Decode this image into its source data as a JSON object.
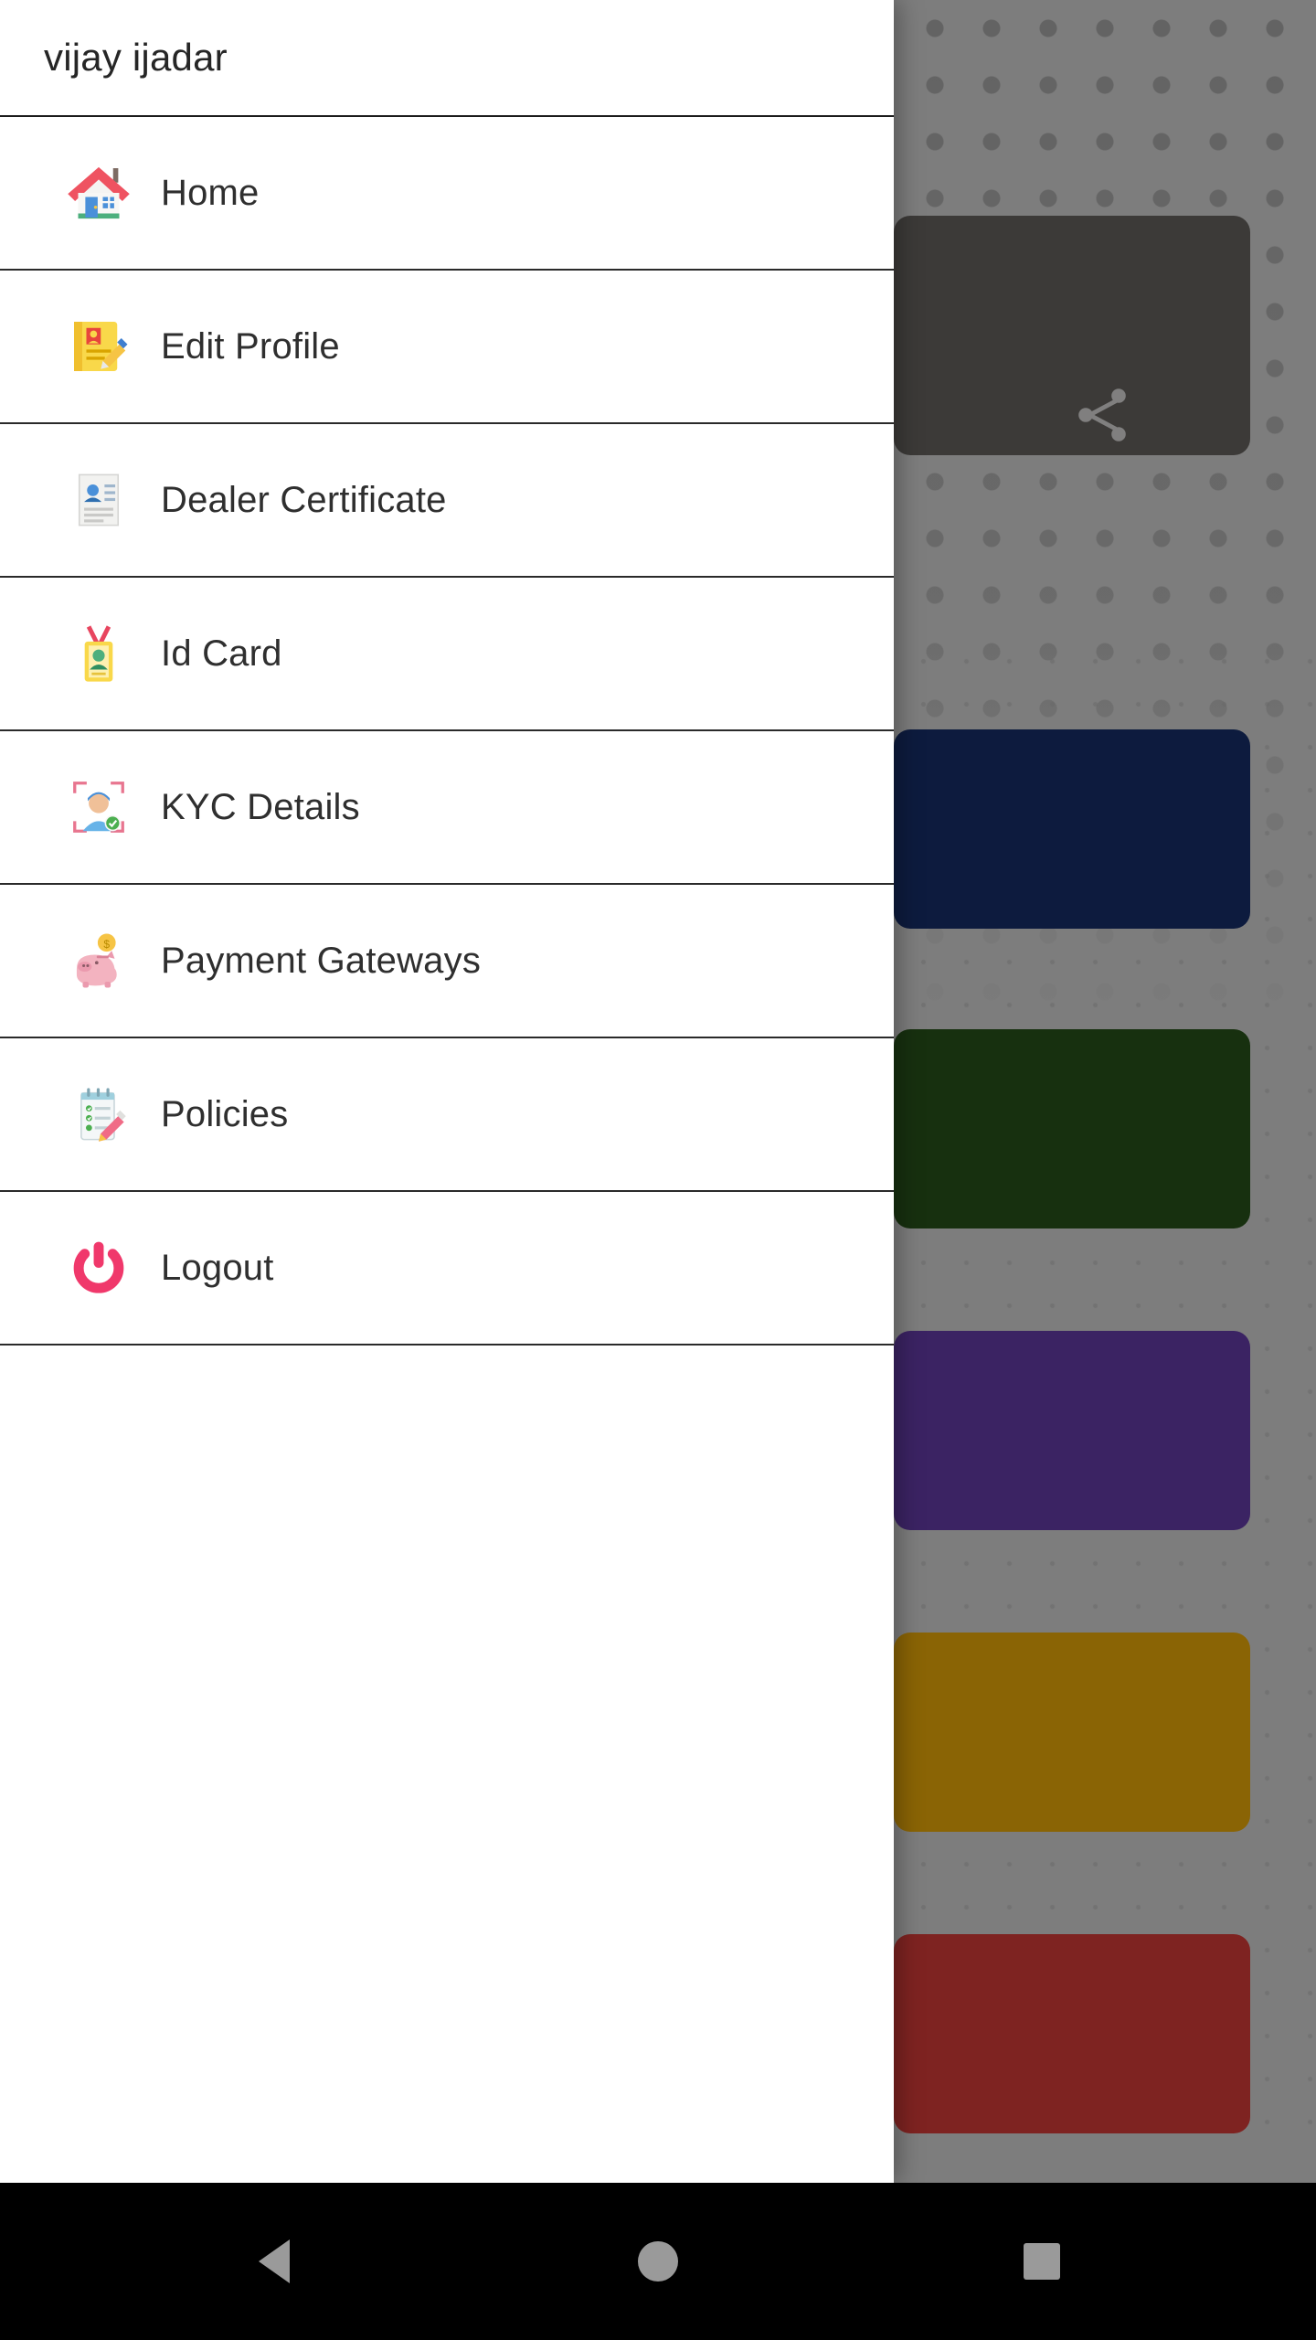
{
  "drawer": {
    "header": {
      "user_name": "vijay ijadar"
    },
    "items": [
      {
        "label": "Home",
        "icon": "house-icon"
      },
      {
        "label": "Edit Profile",
        "icon": "edit-profile-icon"
      },
      {
        "label": "Dealer Certificate",
        "icon": "certificate-icon"
      },
      {
        "label": "Id Card",
        "icon": "id-card-icon"
      },
      {
        "label": "KYC Details",
        "icon": "kyc-face-verify-icon"
      },
      {
        "label": "Payment Gateways",
        "icon": "piggy-bank-icon"
      },
      {
        "label": "Policies",
        "icon": "policy-notepad-icon"
      },
      {
        "label": "Logout",
        "icon": "power-off-icon"
      }
    ]
  },
  "background": {
    "share_card": {
      "icon": "share-icon"
    },
    "cards": [
      {
        "color": "#0d1b3e"
      },
      {
        "color": "#17300f"
      },
      {
        "color": "#3b2363"
      },
      {
        "color": "#8a6405"
      },
      {
        "color": "#7e2321"
      }
    ]
  },
  "nav_bar": {
    "back": "back-triangle-icon",
    "home": "home-circle-icon",
    "recents": "recents-square-icon"
  },
  "colors": {
    "drawer_background": "#ffffff",
    "drawer_text": "#2f2f2f",
    "divider": "#2a2a2a",
    "scrim": "#7d7d7d",
    "logout_accent": "#f0386b",
    "nav_bar": "#000000"
  }
}
